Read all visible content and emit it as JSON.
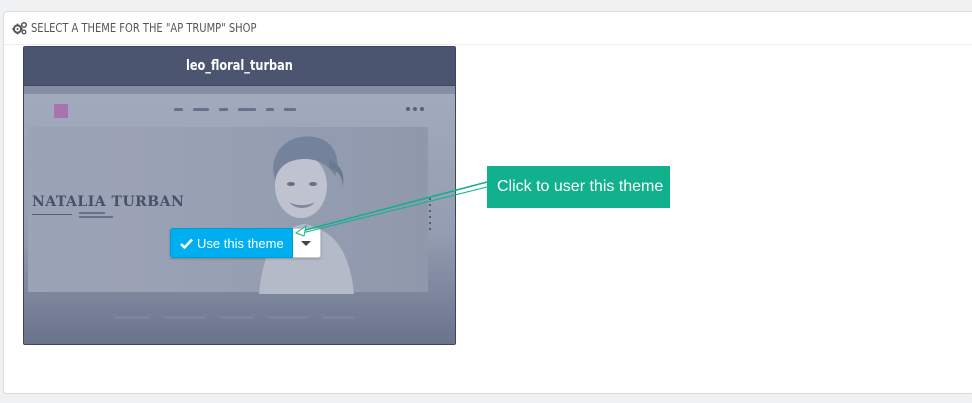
{
  "panel": {
    "heading": "SELECT A THEME FOR THE \"AP TRUMP\" SHOP",
    "heading_icon": "gears-icon"
  },
  "theme_card": {
    "name": "leo_floral_turban",
    "preview_headline": "NATALIA TURBAN"
  },
  "actions": {
    "use_label": "Use this theme",
    "use_icon": "check-icon",
    "dropdown_icon": "caret-down-icon",
    "accent": "#00aff0"
  },
  "callout": {
    "text": "Click to user this theme",
    "color": "#10b18c"
  }
}
